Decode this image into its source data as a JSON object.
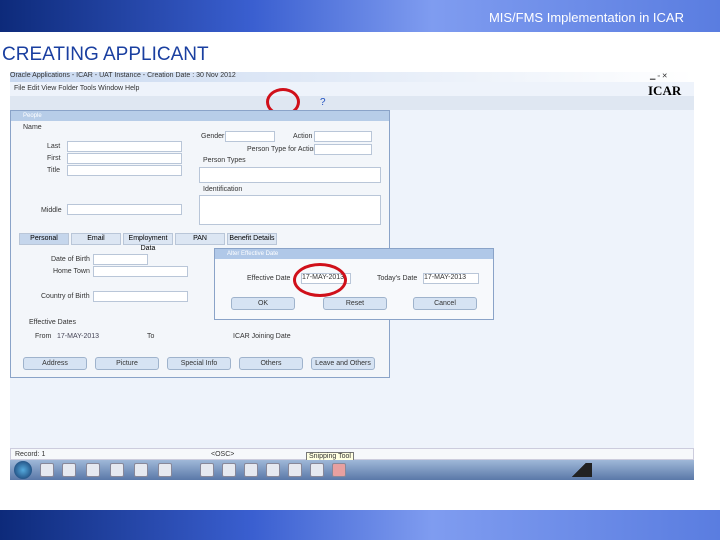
{
  "slide": {
    "header": "MIS/FMS Implementation in ICAR",
    "title": "CREATING APPLICANT"
  },
  "app": {
    "title": "Oracle Applications - ICAR - UAT Instance - Creation Date : 30 Nov 2012",
    "menu": "File  Edit  View  Folder  Tools  Window  Help",
    "logo": "ICAR"
  },
  "people": {
    "title": "People",
    "name_group": "Name",
    "last": "Last",
    "first": "First",
    "title_label": "Title",
    "middle": "Middle",
    "gender": "Gender",
    "action": "Action",
    "person_type_action": "Person Type for Action",
    "person_types": "Person Types",
    "identification": "Identification",
    "tabs": [
      "Personal",
      "Email",
      "Employment Data",
      "PAN",
      "Benefit Details"
    ],
    "date_of_birth": "Date of Birth",
    "town_of_birth": "Home Town",
    "country_of_birth": "Country of Birth",
    "effective_dates": "Effective Dates",
    "from_label": "From",
    "from_value": "17-MAY-2013",
    "to_label": "To",
    "joining_date": "ICAR Joining Date",
    "buttons": [
      "Address",
      "Picture",
      "Special Info",
      "Others",
      "Leave and Others"
    ]
  },
  "dialog": {
    "title": "Alter Effective Date",
    "effective_date_label": "Effective Date",
    "effective_date": "17-MAY-2013",
    "todays_date_label": "Today's Date",
    "todays_date": "17-MAY-2013",
    "ok": "OK",
    "reset": "Reset",
    "cancel": "Cancel"
  },
  "status": {
    "record": "Record: 1",
    "mode": "<OSC>"
  },
  "tooltip": "Snipping Tool"
}
